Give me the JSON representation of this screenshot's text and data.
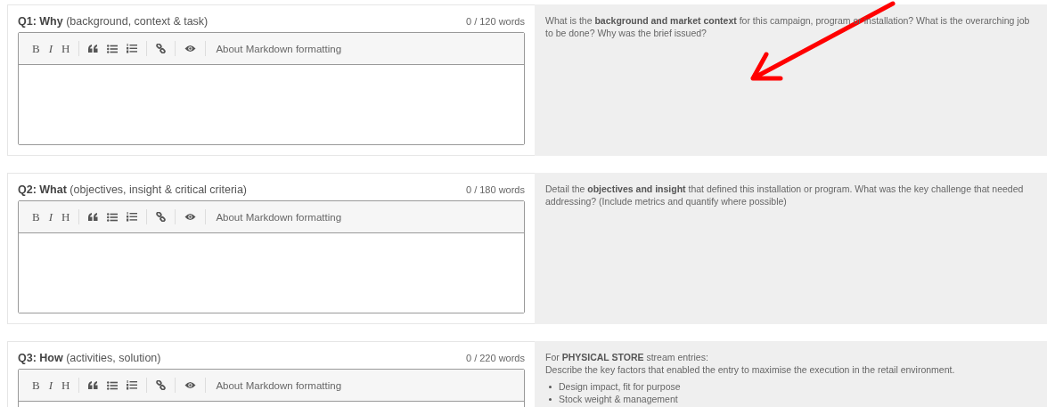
{
  "sections": [
    {
      "title": "**Q1: Why** (background, context & task)",
      "word_count": "0 / 120 words",
      "toolbar": [
        {
          "kind": "letter",
          "label": "B"
        },
        {
          "kind": "letter",
          "label": "I"
        },
        {
          "kind": "letter",
          "label": "H"
        },
        {
          "kind": "separator"
        },
        {
          "kind": "quote"
        },
        {
          "kind": "bullets"
        },
        {
          "kind": "numbers"
        },
        {
          "kind": "separator"
        },
        {
          "kind": "link"
        },
        {
          "kind": "separator"
        },
        {
          "kind": "preview"
        },
        {
          "kind": "separator"
        },
        {
          "kind": "help",
          "label": "About Markdown formatting"
        }
      ],
      "hint": {
        "paragraphs": [
          "What is the **background and market context** for this campaign, program or installation? What is the overarching job to be done? Why was the brief issued?"
        ]
      }
    },
    {
      "title": "**Q2: What** (objectives, insight & critical criteria)",
      "word_count": "0 / 180 words",
      "toolbar": [
        {
          "kind": "letter",
          "label": "B"
        },
        {
          "kind": "letter",
          "label": "I"
        },
        {
          "kind": "letter",
          "label": "H"
        },
        {
          "kind": "separator"
        },
        {
          "kind": "quote"
        },
        {
          "kind": "bullets"
        },
        {
          "kind": "numbers"
        },
        {
          "kind": "separator"
        },
        {
          "kind": "link"
        },
        {
          "kind": "separator"
        },
        {
          "kind": "preview"
        },
        {
          "kind": "separator"
        },
        {
          "kind": "help",
          "label": "About Markdown formatting"
        }
      ],
      "hint": {
        "paragraphs": [
          "Detail the **objectives and insight** that defined this installation or program. What was the key challenge that needed addressing? (Include metrics and quantify where possible)"
        ]
      }
    },
    {
      "title": "**Q3: How** (activities, solution)",
      "word_count": "0 / 220 words",
      "toolbar": [
        {
          "kind": "letter",
          "label": "B"
        },
        {
          "kind": "letter",
          "label": "I"
        },
        {
          "kind": "letter",
          "label": "H"
        },
        {
          "kind": "separator"
        },
        {
          "kind": "quote"
        },
        {
          "kind": "bullets"
        },
        {
          "kind": "numbers"
        },
        {
          "kind": "separator"
        },
        {
          "kind": "link"
        },
        {
          "kind": "separator"
        },
        {
          "kind": "preview"
        },
        {
          "kind": "separator"
        },
        {
          "kind": "help",
          "label": "About Markdown formatting"
        }
      ],
      "hint": {
        "paragraphs": [
          "For **PHYSICAL STORE** stream entries:",
          "Describe the key factors that enabled the entry to maximise the execution in the retail environment."
        ],
        "bullets": [
          "Design impact, fit for purpose",
          "Stock weight & management"
        ]
      }
    }
  ],
  "annotation": {
    "kind": "arrow"
  }
}
